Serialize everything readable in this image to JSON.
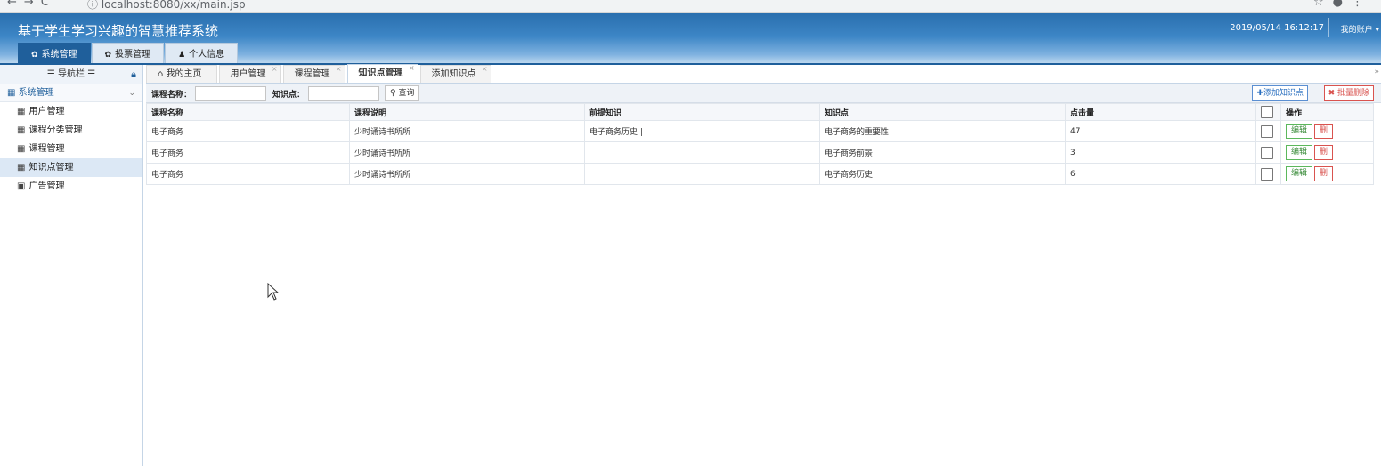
{
  "browser": {
    "url": "localhost:8080/xx/main.jsp"
  },
  "header": {
    "title": "基于学生学习兴趣的智慧推荐系统",
    "datetime": "2019/05/14 16:12:17",
    "account": "我的账户",
    "tabs": [
      {
        "label": "系统管理",
        "icon": "gear-icon"
      },
      {
        "label": "投票管理",
        "icon": "gear-icon"
      },
      {
        "label": "个人信息",
        "icon": "user-icon"
      }
    ]
  },
  "sidebar": {
    "title": "导航栏",
    "group": "系统管理",
    "items": [
      {
        "label": "用户管理"
      },
      {
        "label": "课程分类管理"
      },
      {
        "label": "课程管理"
      },
      {
        "label": "知识点管理"
      },
      {
        "label": "广告管理"
      }
    ]
  },
  "content_tabs": [
    {
      "label": "我的主页"
    },
    {
      "label": "用户管理"
    },
    {
      "label": "课程管理"
    },
    {
      "label": "知识点管理"
    },
    {
      "label": "添加知识点"
    }
  ],
  "search": {
    "course_label": "课程名称：",
    "point_label": "知识点：",
    "search_button": "查询",
    "add_button": "添加知识点",
    "batch_delete_button": "批量删除"
  },
  "table": {
    "headers": [
      "课程名称",
      "课程说明",
      "前提知识",
      "知识点",
      "点击量",
      "操作"
    ],
    "rows": [
      {
        "course": "电子商务",
        "desc": "少时诵诗书所所",
        "prereq": "电子商务历史 |",
        "point": "电子商务的重要性",
        "clicks": "47"
      },
      {
        "course": "电子商务",
        "desc": "少时诵诗书所所",
        "prereq": "",
        "point": "电子商务前景",
        "clicks": "3"
      },
      {
        "course": "电子商务",
        "desc": "少时诵诗书所所",
        "prereq": "",
        "point": "电子商务历史",
        "clicks": "6"
      }
    ],
    "edit_label": "编辑",
    "delete_label": "删"
  }
}
